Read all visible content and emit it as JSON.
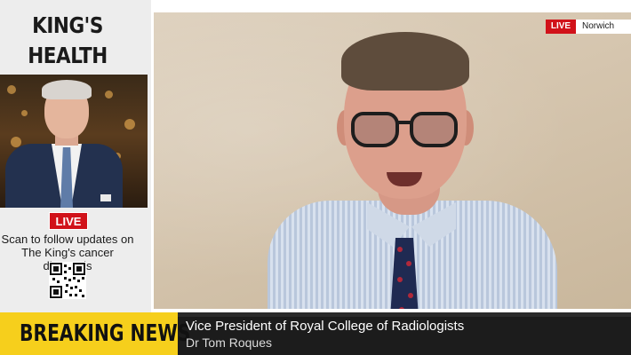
{
  "sidebar": {
    "title_line1": "KING'S",
    "title_line2": "HEALTH",
    "live_label": "LIVE",
    "caption_line1": "Scan to follow updates on",
    "caption_line2": "The King's cancer diagnosis",
    "qr_icon": "qr-code-icon"
  },
  "video": {
    "live_label": "LIVE",
    "location": "Norwich"
  },
  "ticker": {
    "breaking_label": "BREAKING NEWS",
    "headline": "Vice President of Royal College of Radiologists",
    "name": "Dr Tom Roques"
  },
  "colors": {
    "live_red": "#d1121a",
    "breaking_yellow": "#f6cf1c",
    "ticker_bg": "#1c1c1c"
  }
}
